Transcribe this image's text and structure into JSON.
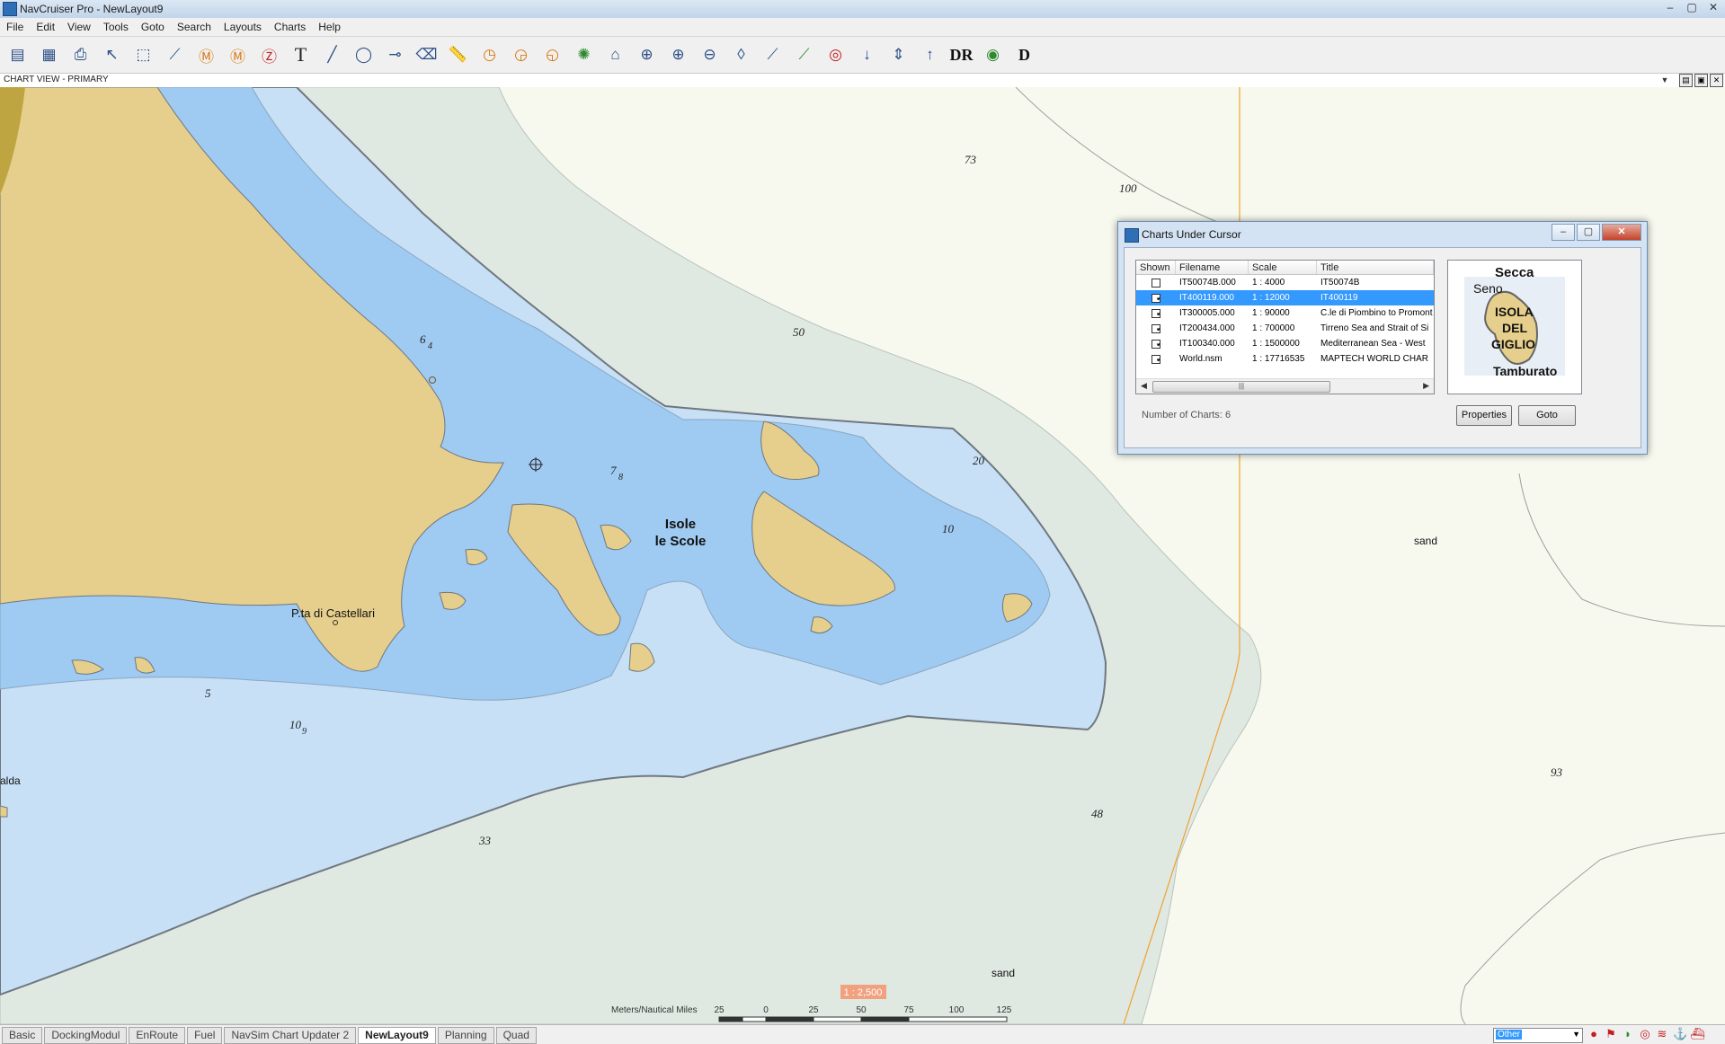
{
  "window": {
    "title": "NavCruiser Pro - NewLayout9",
    "controls": [
      "–",
      "▢",
      "✕"
    ]
  },
  "menu": [
    "File",
    "Edit",
    "View",
    "Tools",
    "Goto",
    "Search",
    "Layouts",
    "Charts",
    "Help"
  ],
  "toolbar": {
    "tools": [
      {
        "name": "abc-tool",
        "glyph": "▤"
      },
      {
        "name": "table-tool",
        "glyph": "▦"
      },
      {
        "name": "print-tool",
        "glyph": "⎙"
      },
      {
        "name": "pointer-tool",
        "glyph": "↖"
      },
      {
        "name": "select-rect-tool",
        "glyph": "⬚"
      },
      {
        "name": "route-tool",
        "glyph": "⟋"
      },
      {
        "name": "mark-m-tool",
        "glyph": "Ⓜ"
      },
      {
        "name": "mark-m2-tool",
        "glyph": "Ⓜ"
      },
      {
        "name": "zone-z-tool",
        "glyph": "Ⓩ"
      },
      {
        "name": "text-tool",
        "glyph": "T"
      },
      {
        "name": "line-tool",
        "glyph": "╱"
      },
      {
        "name": "ellipse-tool",
        "glyph": "◯"
      },
      {
        "name": "drbl-tool",
        "glyph": "⊸"
      },
      {
        "name": "clear-drbl-tool",
        "glyph": "⌫"
      },
      {
        "name": "ruler-tool",
        "glyph": "📏"
      },
      {
        "name": "compass1-tool",
        "glyph": "◷"
      },
      {
        "name": "compass2-tool",
        "glyph": "◶"
      },
      {
        "name": "compass3-tool",
        "glyph": "◵"
      },
      {
        "name": "world-tool",
        "glyph": "✺"
      },
      {
        "name": "home-tool",
        "glyph": "⌂"
      },
      {
        "name": "zoom-area-tool",
        "glyph": "⊕"
      },
      {
        "name": "zoom-in-tool",
        "glyph": "⊕"
      },
      {
        "name": "zoom-out-tool",
        "glyph": "⊖"
      },
      {
        "name": "pin-tool",
        "glyph": "◊"
      },
      {
        "name": "track1-tool",
        "glyph": "⟋"
      },
      {
        "name": "track2-tool",
        "glyph": "⟋"
      },
      {
        "name": "lifering-tool",
        "glyph": "◎"
      },
      {
        "name": "arrow-down-tool",
        "glyph": "↓"
      },
      {
        "name": "arrows-vertical-tool",
        "glyph": "⇕"
      },
      {
        "name": "arrow-up-tool",
        "glyph": "↑"
      },
      {
        "name": "dr-tool",
        "glyph": "DR"
      },
      {
        "name": "gps-tool",
        "glyph": "◉"
      },
      {
        "name": "d-tool",
        "glyph": "D"
      }
    ]
  },
  "view": {
    "title": "CHART VIEW - PRIMARY"
  },
  "map": {
    "depths": [
      "73",
      "100",
      "50",
      "20",
      "10",
      "5",
      "33",
      "48",
      "93"
    ],
    "depths_split": [
      {
        "major": "6",
        "minor": "4"
      },
      {
        "major": "7",
        "minor": "8"
      },
      {
        "major": "10",
        "minor": "9"
      }
    ],
    "place_names": [
      "Isole",
      "le Scole",
      "P.ta di Castellari",
      "alda"
    ],
    "seabed": [
      "sand",
      "sand"
    ],
    "scale_ratio": "1 : 2,500",
    "scale_units": "Meters/Nautical Miles",
    "scale_ticks": [
      "25",
      "0",
      "25",
      "50",
      "75",
      "100",
      "125"
    ]
  },
  "dialog": {
    "title": "Charts Under Cursor",
    "columns": [
      "Shown",
      "Filename",
      "Scale",
      "Title"
    ],
    "rows": [
      {
        "shown": false,
        "filename": "IT50074B.000",
        "scale": "1 : 4000",
        "title": "IT50074B"
      },
      {
        "shown": true,
        "filename": "IT400119.000",
        "scale": "1 : 12000",
        "title": "IT400119",
        "selected": true
      },
      {
        "shown": true,
        "filename": "IT300005.000",
        "scale": "1 : 90000",
        "title": "C.le di Piombino to Promont"
      },
      {
        "shown": true,
        "filename": "IT200434.000",
        "scale": "1 : 700000",
        "title": "Tirreno Sea and Strait of Si"
      },
      {
        "shown": true,
        "filename": "IT100340.000",
        "scale": "1 : 1500000",
        "title": "Mediterranean Sea - West"
      },
      {
        "shown": true,
        "filename": "World.nsm",
        "scale": "1 : 17716535",
        "title": "MAPTECH WORLD CHAR"
      }
    ],
    "preview_labels": [
      "Secca",
      "Seno",
      "ISOLA",
      "DEL",
      "GIGLIO",
      "Tamburato"
    ],
    "count_label": "Number of Charts:",
    "count_value": "6",
    "properties_label": "Properties",
    "goto_label": "Goto"
  },
  "status": {
    "tabs": [
      "Basic",
      "DockingModul",
      "EnRoute",
      "Fuel",
      "NavSim Chart Updater 2",
      "NewLayout9",
      "Planning",
      "Quad"
    ],
    "active_tab": "NewLayout9",
    "dropdown_value": "Other"
  },
  "colors": {
    "land": "#e6cf8c",
    "shallow": "#9fcaf2",
    "medium": "#c7e0f6",
    "deep_shelf": "#dfe9e1",
    "open_sea": "#f7f9ef",
    "contour": "#6f7780",
    "track": "#f0a030"
  }
}
